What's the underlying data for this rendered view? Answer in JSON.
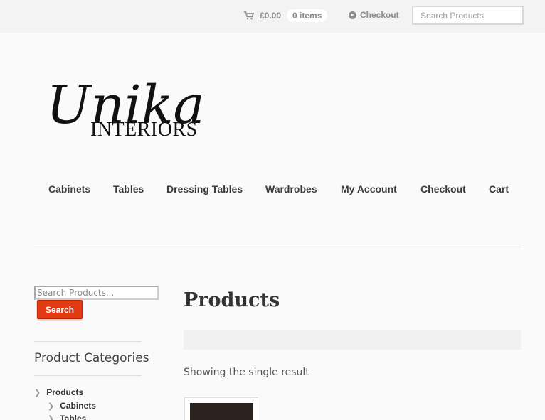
{
  "topbar": {
    "cart_total": "£0.00",
    "cart_items": "0 items",
    "checkout_label": "Checkout",
    "search_placeholder": "Search Products"
  },
  "logo": {
    "text_main": "Unika",
    "text_sub": "INTERIORS"
  },
  "nav": [
    {
      "label": "Cabinets"
    },
    {
      "label": "Tables"
    },
    {
      "label": "Dressing Tables"
    },
    {
      "label": "Wardrobes"
    },
    {
      "label": "My Account"
    },
    {
      "label": "Checkout"
    },
    {
      "label": "Cart"
    }
  ],
  "sidebar": {
    "search_placeholder": "Search Products...",
    "search_button": "Search",
    "categories_title": "Product Categories",
    "categories": [
      {
        "label": "Products"
      },
      {
        "label": "Cabinets"
      },
      {
        "label": "Tables"
      }
    ]
  },
  "main": {
    "title": "Products",
    "result_count": "Showing the single result"
  },
  "colors": {
    "accent": "#e23a12",
    "text": "#333333"
  },
  "icons": [
    "cart-icon",
    "arrow-circle-icon",
    "chevron-right-icon"
  ]
}
